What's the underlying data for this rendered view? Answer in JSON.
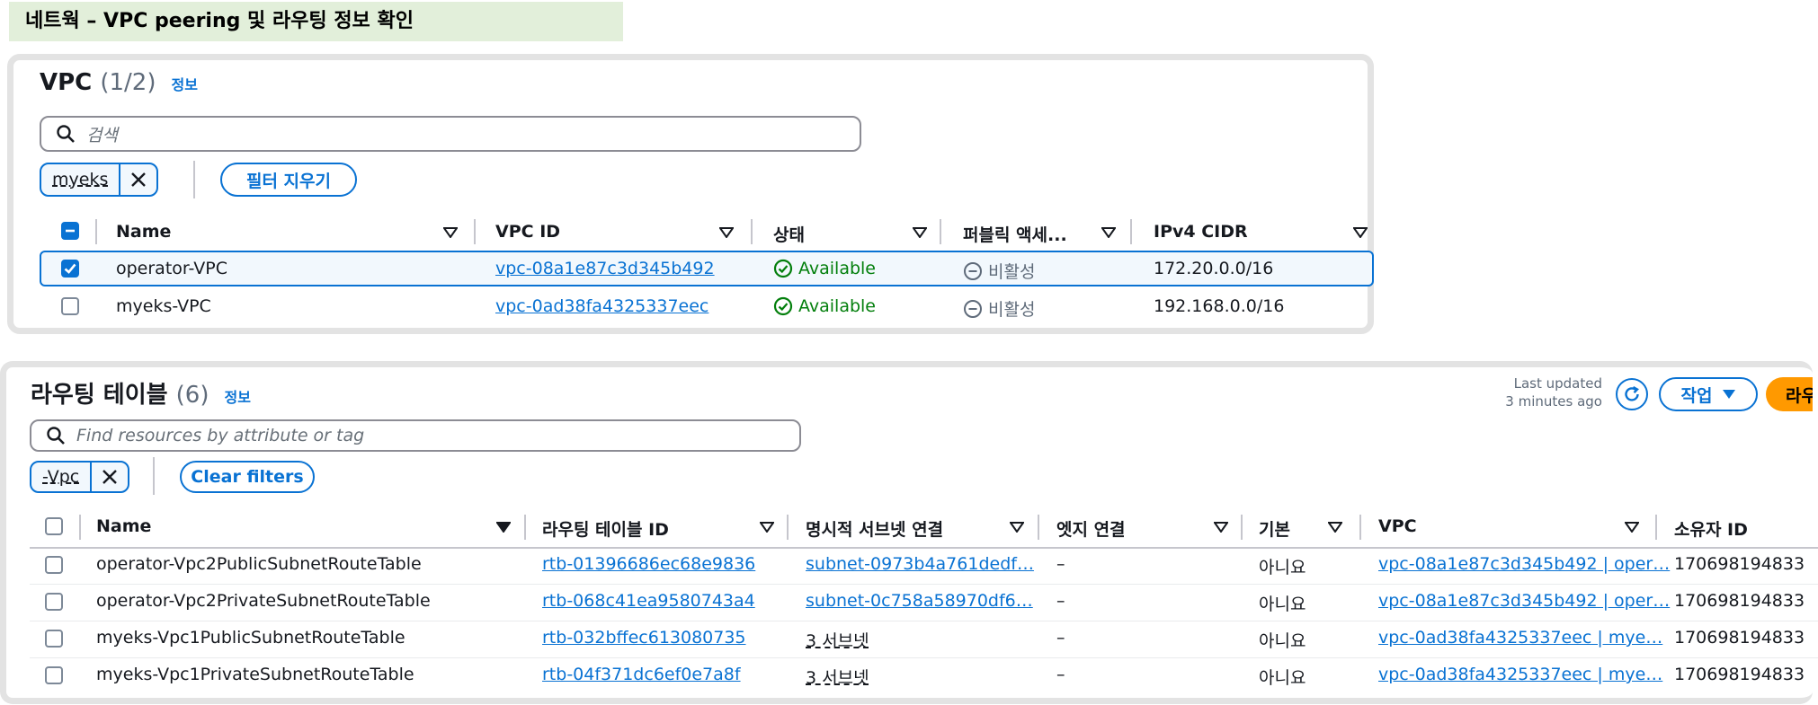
{
  "banner": {
    "title": "네트웍 – VPC peering 및 라우팅 정보 확인"
  },
  "vpc_panel": {
    "title": "VPC",
    "count": "(1/2)",
    "info": "정보",
    "search_placeholder": "검색",
    "filter_token": "myeks",
    "clear_filter_label": "필터 지우기",
    "columns": [
      "Name",
      "VPC ID",
      "상태",
      "퍼블릭 액세...",
      "IPv4 CIDR"
    ],
    "rows": [
      {
        "name": "operator-VPC",
        "vpc_id": "vpc-08a1e87c3d345b492",
        "status": "Available",
        "public_access": "비활성",
        "cidr": "172.20.0.0/16",
        "selected": true
      },
      {
        "name": "myeks-VPC",
        "vpc_id": "vpc-0ad38fa4325337eec",
        "status": "Available",
        "public_access": "비활성",
        "cidr": "192.168.0.0/16",
        "selected": false
      }
    ]
  },
  "rt_panel": {
    "title": "라우팅 테이블",
    "count": "(6)",
    "info": "정보",
    "last_updated_line1": "Last updated",
    "last_updated_line2": "3 minutes ago",
    "actions_label": "작업",
    "create_label": "라우",
    "search_placeholder": "Find resources by attribute or tag",
    "filter_token": "-Vpc",
    "clear_filter_label": "Clear filters",
    "columns": [
      "Name",
      "라우팅 테이블 ID",
      "명시적 서브넷 연결",
      "엣지 연결",
      "기본",
      "VPC",
      "소유자 ID"
    ],
    "rows": [
      {
        "name": "operator-Vpc2PublicSubnetRouteTable",
        "rt_id": "rtb-01396686ec68e9836",
        "subnet": "subnet-0973b4a761dedf…",
        "subnet_is_link": true,
        "edge": "–",
        "main": "아니요",
        "vpc": "vpc-08a1e87c3d345b492 | oper…",
        "owner": "170698194833"
      },
      {
        "name": "operator-Vpc2PrivateSubnetRouteTable",
        "rt_id": "rtb-068c41ea9580743a4",
        "subnet": "subnet-0c758a58970df6…",
        "subnet_is_link": true,
        "edge": "–",
        "main": "아니요",
        "vpc": "vpc-08a1e87c3d345b492 | oper…",
        "owner": "170698194833"
      },
      {
        "name": "myeks-Vpc1PublicSubnetRouteTable",
        "rt_id": "rtb-032bffec613080735",
        "subnet": "3 서브넷",
        "subnet_is_link": false,
        "edge": "–",
        "main": "아니요",
        "vpc": "vpc-0ad38fa4325337eec | mye…",
        "owner": "170698194833"
      },
      {
        "name": "myeks-Vpc1PrivateSubnetRouteTable",
        "rt_id": "rtb-04f371dc6ef0e7a8f",
        "subnet": "3 서브넷",
        "subnet_is_link": false,
        "edge": "–",
        "main": "아니요",
        "vpc": "vpc-0ad38fa4325337eec | mye…",
        "owner": "170698194833"
      }
    ]
  }
}
